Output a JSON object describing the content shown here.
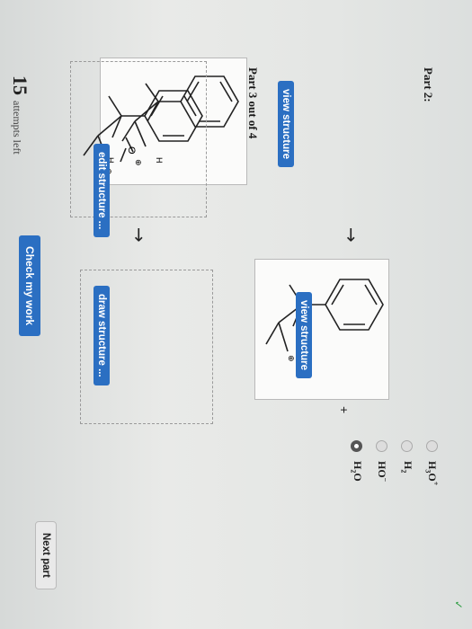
{
  "part2": {
    "heading": "Part 2:",
    "reactant": {
      "h_top": "H",
      "o_label": "O",
      "o_charge": "⊕",
      "h_bottom": "H",
      "button": "view structure"
    },
    "arrow": "→",
    "product": {
      "charge": "⊕",
      "button": "view structure"
    },
    "plus": "+",
    "options": [
      {
        "main": "H",
        "sub": "3",
        "tail": "O",
        "sup": "+",
        "selected": false
      },
      {
        "main": "H",
        "sub": "2",
        "tail": "",
        "sup": "",
        "selected": false
      },
      {
        "main": "HO",
        "sub": "",
        "tail": "",
        "sup": "−",
        "selected": false
      },
      {
        "main": "H",
        "sub": "2",
        "tail": "O",
        "sup": "",
        "selected": true
      }
    ]
  },
  "part3": {
    "heading": "Part 3 out of 4",
    "start": {
      "charge": "⊕",
      "button": "edit structure ..."
    },
    "arrow": "→",
    "target": {
      "button": "draw structure ..."
    }
  },
  "footer": {
    "attempts_count": "15",
    "attempts_label": "attempts left",
    "check_button": "Check my work",
    "next_button": "Next part"
  },
  "status": {
    "check_icon": "✓"
  }
}
